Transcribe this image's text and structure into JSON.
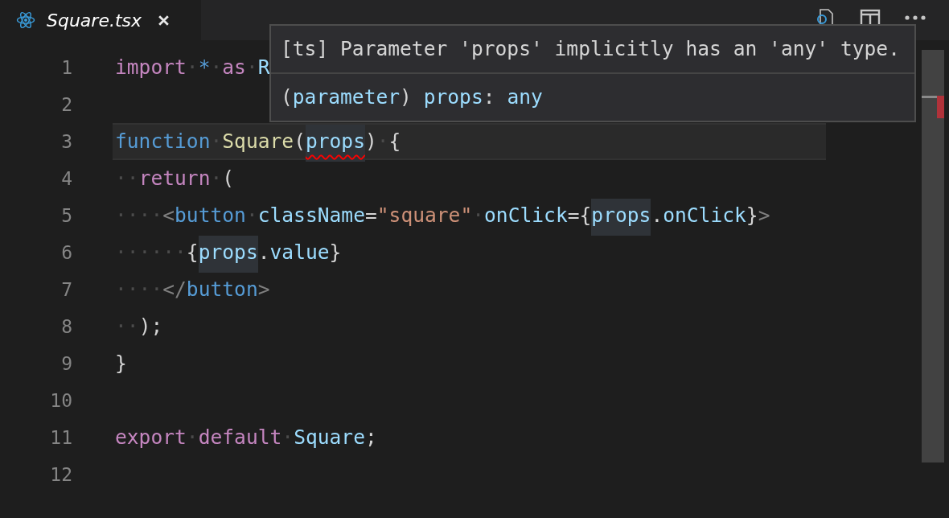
{
  "tab": {
    "label": "Square.tsx",
    "selected": true
  },
  "lines": [
    {
      "number": "1",
      "current": false,
      "tokens": [
        {
          "text": "import",
          "kind": "control"
        },
        {
          "text": "·",
          "kind": "ws"
        },
        {
          "text": "*",
          "kind": "keyword"
        },
        {
          "text": "·",
          "kind": "ws"
        },
        {
          "text": "as",
          "kind": "control"
        },
        {
          "text": "·",
          "kind": "ws"
        },
        {
          "text": "R",
          "kind": "var"
        }
      ]
    },
    {
      "number": "2",
      "current": false
    },
    {
      "number": "3",
      "current": true,
      "tokens": [
        {
          "text": "function",
          "kind": "keyword"
        },
        {
          "text": "·",
          "kind": "ws"
        },
        {
          "text": "Square",
          "kind": "fn"
        },
        {
          "text": "(",
          "kind": "punc"
        },
        {
          "text": "props",
          "kind": "var",
          "highlight": true,
          "error": true
        },
        {
          "text": ")",
          "kind": "punc"
        },
        {
          "text": "·",
          "kind": "ws"
        },
        {
          "text": "{",
          "kind": "punc"
        }
      ]
    },
    {
      "number": "4",
      "current": false,
      "tokens": [
        {
          "text": "··",
          "kind": "ws"
        },
        {
          "text": "return",
          "kind": "control"
        },
        {
          "text": "·",
          "kind": "ws"
        },
        {
          "text": "(",
          "kind": "punc"
        }
      ]
    },
    {
      "number": "5",
      "current": false,
      "tokens": [
        {
          "text": "····",
          "kind": "ws"
        },
        {
          "text": "<",
          "kind": "bracket"
        },
        {
          "text": "button",
          "kind": "keyword"
        },
        {
          "text": "·",
          "kind": "ws"
        },
        {
          "text": "className",
          "kind": "var"
        },
        {
          "text": "=",
          "kind": "punc"
        },
        {
          "text": "\"square\"",
          "kind": "str"
        },
        {
          "text": "·",
          "kind": "ws"
        },
        {
          "text": "onClick",
          "kind": "var"
        },
        {
          "text": "={",
          "kind": "punc"
        },
        {
          "text": "props",
          "kind": "var",
          "highlight": true
        },
        {
          "text": ".",
          "kind": "punc"
        },
        {
          "text": "onClick",
          "kind": "var"
        },
        {
          "text": "}",
          "kind": "punc"
        },
        {
          "text": ">",
          "kind": "bracket"
        }
      ]
    },
    {
      "number": "6",
      "current": false,
      "tokens": [
        {
          "text": "······",
          "kind": "ws"
        },
        {
          "text": "{",
          "kind": "punc"
        },
        {
          "text": "props",
          "kind": "var",
          "highlight": true
        },
        {
          "text": ".",
          "kind": "punc"
        },
        {
          "text": "value",
          "kind": "var"
        },
        {
          "text": "}",
          "kind": "punc"
        }
      ]
    },
    {
      "number": "7",
      "current": false,
      "tokens": [
        {
          "text": "····",
          "kind": "ws"
        },
        {
          "text": "</",
          "kind": "bracket"
        },
        {
          "text": "button",
          "kind": "keyword"
        },
        {
          "text": ">",
          "kind": "bracket"
        }
      ]
    },
    {
      "number": "8",
      "current": false,
      "tokens": [
        {
          "text": "··",
          "kind": "ws"
        },
        {
          "text": ");",
          "kind": "punc"
        }
      ]
    },
    {
      "number": "9",
      "current": false,
      "tokens": [
        {
          "text": "}",
          "kind": "punc"
        }
      ]
    },
    {
      "number": "10",
      "current": false
    },
    {
      "number": "11",
      "current": false,
      "tokens": [
        {
          "text": "export",
          "kind": "control"
        },
        {
          "text": "·",
          "kind": "ws"
        },
        {
          "text": "default",
          "kind": "control"
        },
        {
          "text": "·",
          "kind": "ws"
        },
        {
          "text": "Square",
          "kind": "var"
        },
        {
          "text": ";",
          "kind": "punc"
        }
      ]
    },
    {
      "number": "12",
      "current": false
    }
  ],
  "hover": {
    "message": "[ts] Parameter 'props' implicitly has an 'any' type.",
    "signature": [
      {
        "text": "(",
        "kind": "punc"
      },
      {
        "text": "parameter",
        "kind": "var"
      },
      {
        "text": ") ",
        "kind": "punc"
      },
      {
        "text": "props",
        "kind": "var"
      },
      {
        "text": ": ",
        "kind": "punc"
      },
      {
        "text": "any",
        "kind": "var"
      }
    ]
  }
}
